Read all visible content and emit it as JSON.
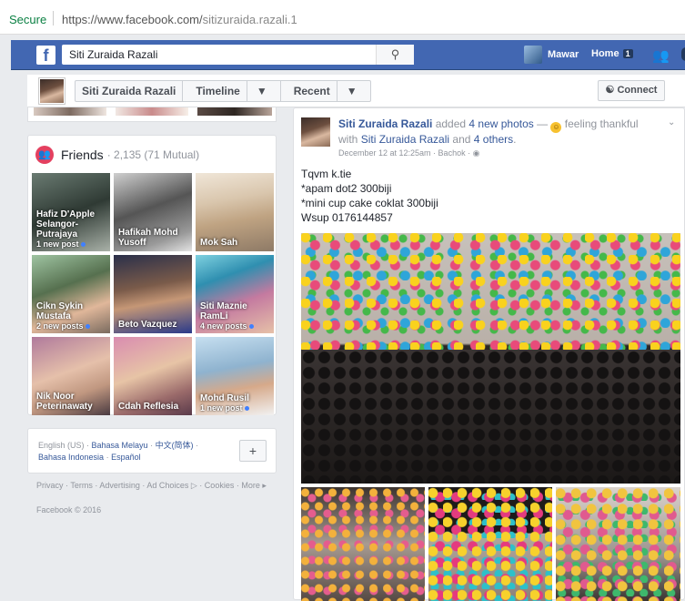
{
  "browser": {
    "secure_label": "Secure",
    "url_prefix": "https://www.facebook.com/",
    "url_path": "sitizuraida.razali.1"
  },
  "topbar": {
    "search_value": "Siti Zuraida Razali",
    "user_name": "Mawar",
    "home_label": "Home",
    "home_count": "1"
  },
  "profile_nav": {
    "name": "Siti Zuraida Razali",
    "timeline": "Timeline",
    "recent": "Recent",
    "connect": "Connect"
  },
  "friends": {
    "title": "Friends",
    "count": "· 2,135 (71 Mutual)",
    "items": [
      {
        "name": "Hafiz D'Apple Selangor-Putrajaya",
        "posts": "1 new post"
      },
      {
        "name": "Hafikah Mohd Yusoff",
        "posts": ""
      },
      {
        "name": "Mok Sah",
        "posts": ""
      },
      {
        "name": "Cikn Sykin Mustafa",
        "posts": "2 new posts"
      },
      {
        "name": "Beto Vazquez",
        "posts": ""
      },
      {
        "name": "Siti Maznie RamLi",
        "posts": "4 new posts"
      },
      {
        "name": "Nik Noor Peterinawaty",
        "posts": ""
      },
      {
        "name": "Cdah Reflesia",
        "posts": ""
      },
      {
        "name": "Mohd Rusil",
        "posts": "1 new post"
      }
    ]
  },
  "languages": {
    "current": "English (US)",
    "sep1": " · ",
    "l2": "Bahasa Melayu",
    "sep2": " · ",
    "l3": "中文(简体)",
    "sep3": " ·",
    "l4": "Bahasa Indonesia",
    "sep4": " · ",
    "l5": "Español",
    "plus": "+"
  },
  "footer": {
    "links": "Privacy · Terms · Advertising · Ad Choices ▷ · Cookies · More ▸",
    "copyright": "Facebook © 2016"
  },
  "post": {
    "author": "Siti Zuraida Razali",
    "added": " added ",
    "photos": "4 new photos",
    "dash": " — ",
    "feeling": " feeling thankful",
    "with": "with ",
    "tag1": "Siti Zuraida Razali",
    "and": " and ",
    "tag2": "4 others",
    "dot": ".",
    "meta": "December 12 at 12:25am · Bachok · ",
    "line1": "Tqvm k.tie",
    "line2": "*apam dot2 300biji",
    "line3": "*mini cup cake coklat 300biji",
    "line4": "Wsup 0176144857"
  },
  "colors": {
    "brand": "#4267b2",
    "link": "#365899",
    "friends_icon": "#e4405f"
  }
}
